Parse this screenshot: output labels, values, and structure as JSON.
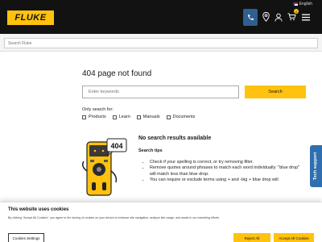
{
  "header": {
    "logo_text": "FLUKE",
    "language": "English",
    "cart_count": "0"
  },
  "search_bar": {
    "placeholder": "Search Fluke"
  },
  "main": {
    "title": "404 page not found",
    "keyword_placeholder": "Enter keywords",
    "search_button": "Search",
    "only_search_label": "Only search for:",
    "filters": [
      "Products",
      "Learn",
      "Manuals",
      "Documents"
    ],
    "illustration_display": "404",
    "no_results": "No search results available",
    "tips_heading": "Search tips",
    "tips": [
      "Check if your spelling is correct, or try removing filter.",
      "Remove quotes around phrases to match each word individually: \"blue drop\" will match less than blue drop.",
      "You can require or exclude terms using + and -big + blue drop will"
    ]
  },
  "tech_support": {
    "label": "Tech support"
  },
  "cookie_banner": {
    "title": "This website uses cookies",
    "text": "By clicking \"Accept All Cookies\", you agree to the storing of cookies on your device to enhance site navigation, analyze site usage, and assist in our marketing efforts.",
    "settings_button": "Cookies Settings",
    "reject_button": "Reject All",
    "accept_button": "Accept All Cookies"
  },
  "colors": {
    "brand_yellow": "#ffc20e",
    "header_bg": "#121212",
    "accent_blue": "#2f5f8f"
  }
}
